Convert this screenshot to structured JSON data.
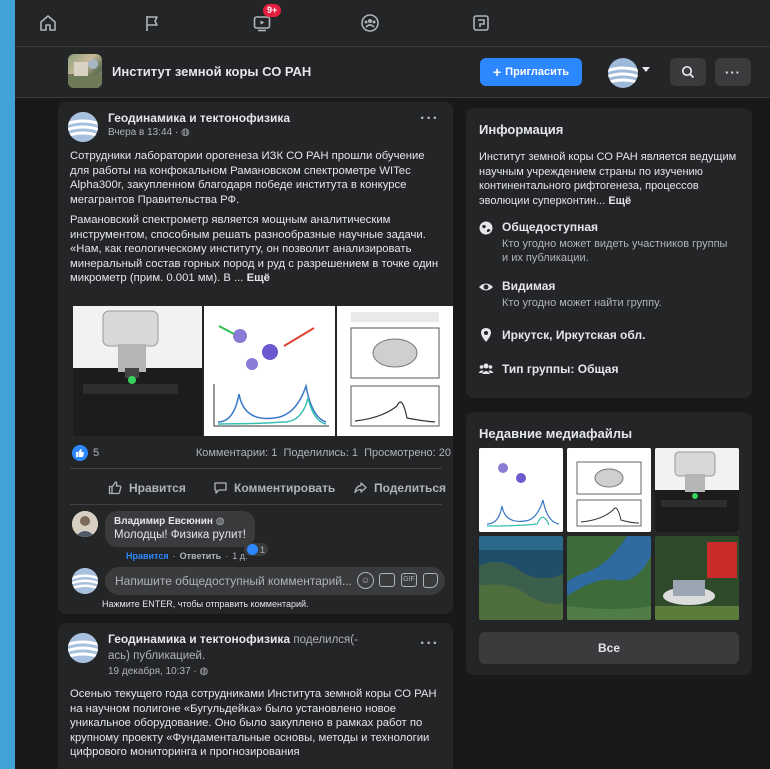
{
  "nav": {
    "video_badge": "9+"
  },
  "group": {
    "name": "Институт земной коры СО РАН",
    "invite_label": "Пригласить"
  },
  "post1": {
    "author": "Геодинамика и тектонофизика",
    "time": "Вчера в 13:44",
    "para1": "Сотрудники лаборатории орогенеза ИЗК СО РАН прошли обучение для работы на конфокальном Рамановском спектрометре WITec Alpha300r, закупленном благодаря победе института в конкурсе мегагрантов Правительства РФ.",
    "para2": "Рамановский спектрометр является мощным аналитическим инструментом, способным решать разнообразные научные задачи. «Нам, как геологическому институту, он позволит анализировать минеральный состав горных пород и руд с разрешением в точке один микрометр (прим. 0.001 мм). В ...",
    "see_more": "Ещё",
    "reactions_count": "5",
    "stats": "Комментарии: 1  Поделились: 1  Просмотрено: 20",
    "like_label": "Нравится",
    "comment_label": "Комментировать",
    "share_label": "Поделиться",
    "comment": {
      "author": "Владимир Евсюнин",
      "text": "Молодцы! Физика рулит!",
      "like": "Нравится",
      "reply": "Ответить",
      "time": "1 д.",
      "reactions": "1"
    },
    "comment_input_placeholder": "Напишите общедоступный комментарий...",
    "enter_hint": "Нажмите ENTER, чтобы отправить комментарий."
  },
  "post2": {
    "author": "Геодинамика и тектонофизика",
    "shared": "поделился(-ась) публикацией.",
    "time": "19 декабря, 10:37",
    "text": "Осенью текущего года сотрудниками Института земной коры СО РАН на научном полигоне «Бугульдейка» было установлено новое уникальное оборудование. Оно было закуплено в рамках работ по крупному проекту «Фундаментальные основы, методы и технологии цифрового мониторинга и прогнозирования"
  },
  "info": {
    "title": "Информация",
    "desc": "Институт земной коры СО РАН является ведущим научным учреждением страны по изучению континентального рифтогенеза, процессов эволюции суперконтин...",
    "see_more": "Ещё",
    "rows": [
      {
        "icon": "globe-icon",
        "title": "Общедоступная",
        "sub": "Кто угодно может видеть участников группы и их публикации."
      },
      {
        "icon": "eye-icon",
        "title": "Видимая",
        "sub": "Кто угодно может найти группу."
      },
      {
        "icon": "location-pin-icon",
        "title": "Иркутск, Иркутская обл.",
        "sub": ""
      },
      {
        "icon": "group-people-icon",
        "title": "Тип группы: Общая",
        "sub": ""
      }
    ]
  },
  "media": {
    "title": "Недавние медиафайлы",
    "all_label": "Все"
  },
  "colors": {
    "accent": "#2d88ff",
    "badge": "#e41e3f",
    "card": "#242526",
    "background": "#18191a"
  }
}
